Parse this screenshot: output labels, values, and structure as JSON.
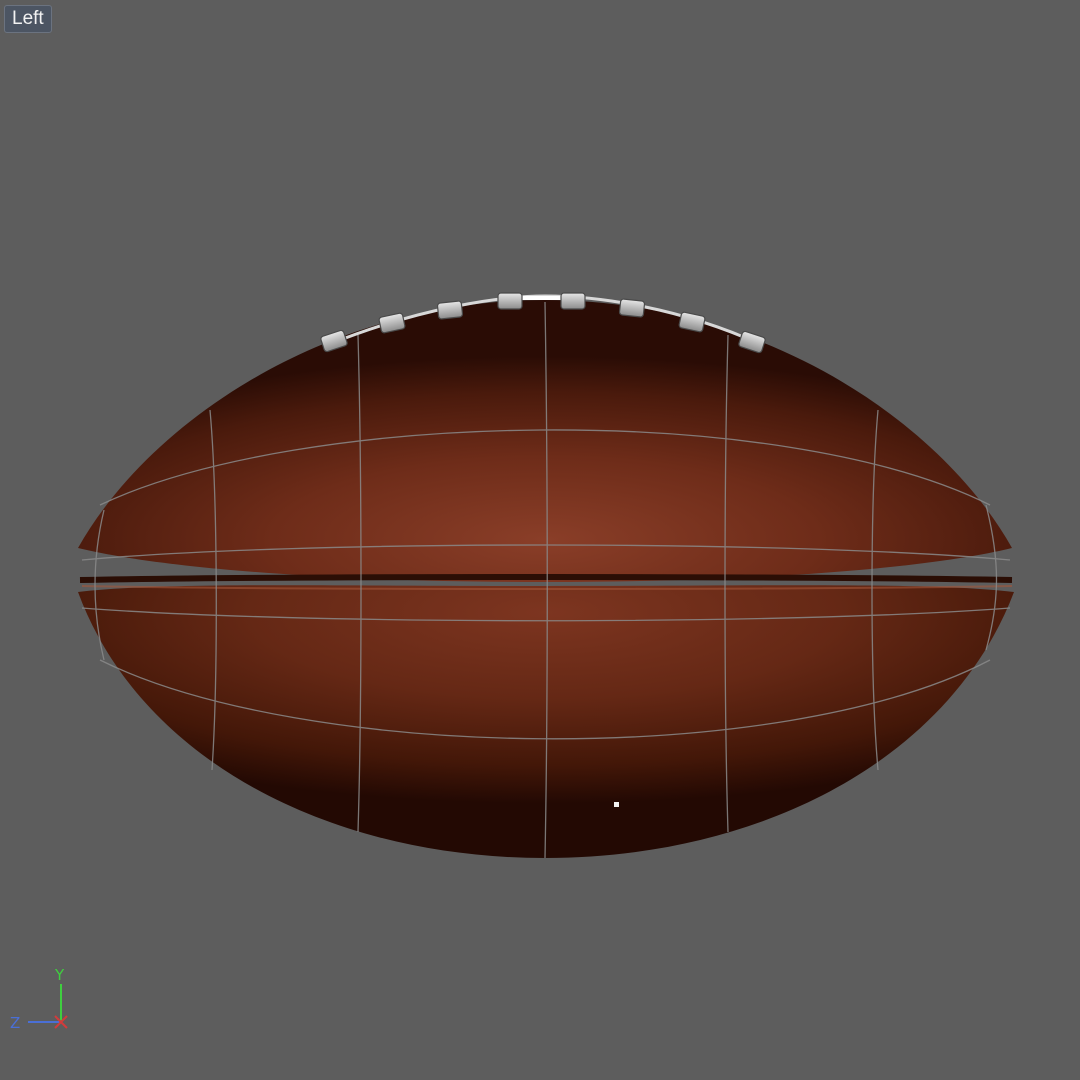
{
  "viewport": {
    "view_label": "Left",
    "background_color": "#5d5d5d"
  },
  "model": {
    "object": "american-football",
    "leather_color": "#7a3420",
    "wireframe_color": "#8a8a8a",
    "lace_color": "#c8c8c8"
  },
  "axis_gizmo": {
    "y_label": "Y",
    "z_label": "Z",
    "y_color": "#3fcf3f",
    "z_color": "#4a6fd6",
    "x_color": "#d23b3b"
  }
}
